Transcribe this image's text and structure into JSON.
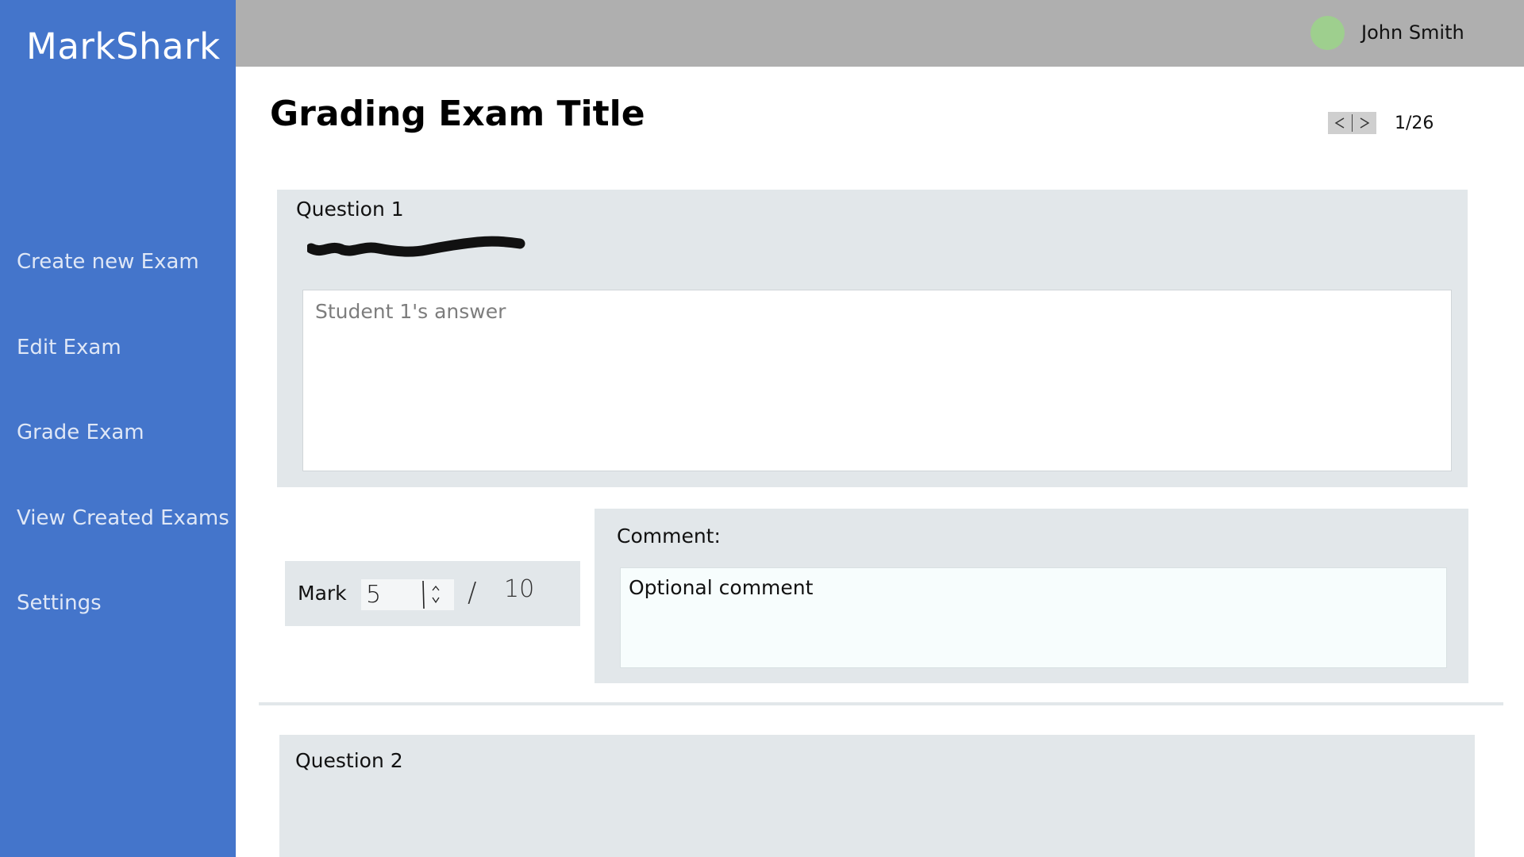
{
  "app": {
    "name": "MarkShark"
  },
  "sidebar": {
    "items": [
      {
        "label": "Create new Exam"
      },
      {
        "label": "Edit Exam"
      },
      {
        "label": "Grade Exam"
      },
      {
        "label": "View Created Exams"
      },
      {
        "label": "Settings"
      }
    ]
  },
  "header": {
    "user_name": "John Smith",
    "avatar_color": "#9ecf8e"
  },
  "page": {
    "title": "Grading Exam Title",
    "pager": {
      "prev_icon": "chevron-left-icon",
      "next_icon": "chevron-right-icon",
      "count": "1/26"
    }
  },
  "questions": [
    {
      "title": "Question 1",
      "answer_placeholder": "Student 1's answer",
      "mark": {
        "label": "Mark",
        "value": "5",
        "separator": "/",
        "max": "10"
      },
      "comment": {
        "label": "Comment:",
        "placeholder": "Optional comment"
      }
    },
    {
      "title": "Question 2"
    }
  ],
  "colors": {
    "sidebar": "#4475cb",
    "topbar": "#afafaf",
    "card": "#e2e7ea"
  }
}
